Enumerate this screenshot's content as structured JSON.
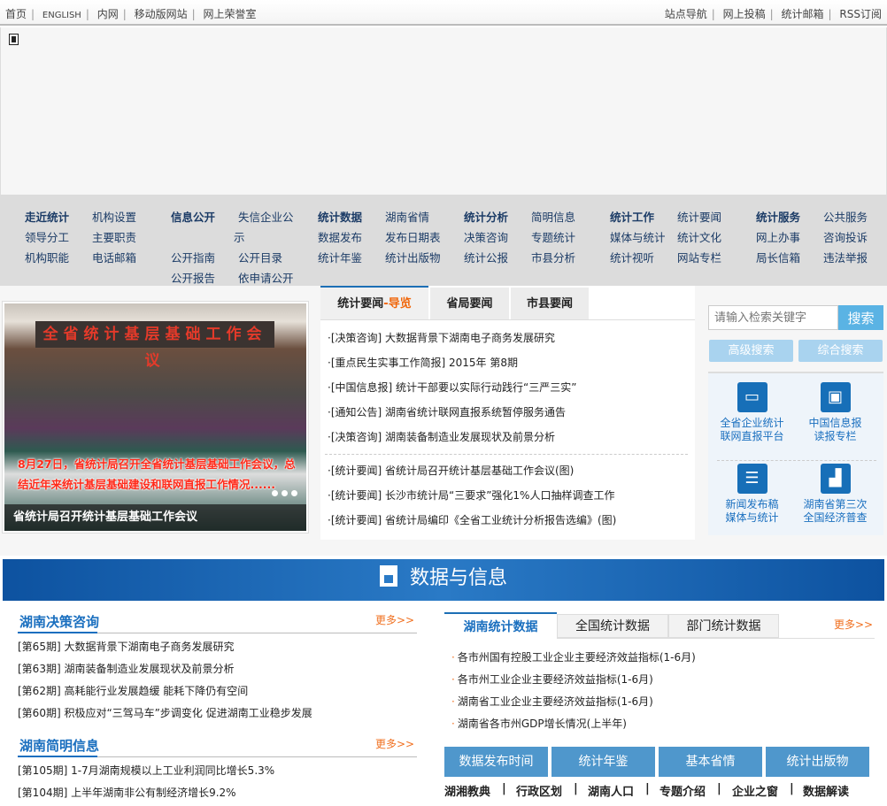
{
  "topbar": {
    "left": [
      "首页",
      "ENGLISH",
      "内网",
      "移动版网站",
      "网上荣誉室"
    ],
    "right": [
      "站点导航",
      "网上投稿",
      "统计邮箱",
      "RSS订阅"
    ]
  },
  "nav": [
    {
      "title": "走近统计",
      "items": [
        "机构设置",
        "领导分工",
        "主要职责",
        "机构职能",
        "电话邮箱"
      ]
    },
    {
      "title": "信息公开",
      "items": [
        "失信企业公",
        "示",
        "公开指南",
        "公开目录",
        "公开报告",
        "依申请公开"
      ]
    },
    {
      "title": "统计数据",
      "items": [
        "湖南省情",
        "数据发布",
        "发布日期表",
        "统计年鉴",
        "统计出版物"
      ]
    },
    {
      "title": "统计分析",
      "items": [
        "简明信息",
        "决策咨询",
        "专题统计",
        "统计公报",
        "市县分析"
      ]
    },
    {
      "title": "统计工作",
      "items": [
        "统计要闻",
        "媒体与统计",
        "统计文化",
        "统计视听",
        "网站专栏"
      ]
    },
    {
      "title": "统计服务",
      "items": [
        "公共服务",
        "网上办事",
        "咨询投诉",
        "局长信箱",
        "违法举报"
      ]
    }
  ],
  "photo": {
    "banner": "全省统计基层基础工作会议",
    "overlay": "8月27日，省统计局召开全省统计基层基础工作会议，总结近年来统计基层基础建设和联网直报工作情况......",
    "caption": "省统计局召开统计基层基础工作会议"
  },
  "news": {
    "tabs": [
      {
        "label": "统计要闻",
        "highlight": "-导览"
      },
      {
        "label": "省局要闻"
      },
      {
        "label": "市县要闻"
      }
    ],
    "items": [
      "·[决策咨询] 大数据背景下湖南电子商务发展研究",
      "·[重点民生实事工作简报] 2015年 第8期",
      "·[中国信息报] 统计干部要以实际行动践行“三严三实”",
      "·[通知公告] 湖南省统计联网直报系统暂停服务通告",
      "·[决策咨询] 湖南装备制造业发展现状及前景分析"
    ],
    "items2": [
      "·[统计要闻] 省统计局召开统计基层基础工作会议(图)",
      "·[统计要闻] 长沙市统计局“三要求”强化1%人口抽样调查工作",
      "·[统计要闻] 省统计局编印《全省工业统计分析报告选编》(图)"
    ]
  },
  "search": {
    "placeholder": "请输入检索关键字",
    "button": "搜索",
    "advanced": "高级搜索",
    "integrated": "综合搜索"
  },
  "quicklinks": [
    {
      "line1": "全省企业统计",
      "line2": "联网直报平台",
      "icon": "monitor-icon"
    },
    {
      "line1": "中国信息报",
      "line2": "读报专栏",
      "icon": "presentation-icon"
    },
    {
      "line1": "新闻发布稿",
      "line2": "媒体与统计",
      "icon": "document-icon"
    },
    {
      "line1": "湖南省第三次",
      "line2": "全国经济普查",
      "icon": "bar-chart-icon"
    }
  ],
  "band": {
    "title": "数据与信息"
  },
  "decision": {
    "title": "湖南决策咨询",
    "more": "更多>>",
    "items": [
      "[第65期] 大数据背景下湖南电子商务发展研究",
      "[第63期] 湖南装备制造业发展现状及前景分析",
      "[第62期] 高耗能行业发展趋缓 能耗下降仍有空间",
      "[第60期] 积极应对“三驾马车”步调变化 促进湖南工业稳步发展"
    ]
  },
  "brief": {
    "title": "湖南简明信息",
    "more": "更多>>",
    "items": [
      "[第105期] 1-7月湖南规模以上工业利润同比增长5.3%",
      "[第104期] 上半年湖南非公有制经济增长9.2%"
    ]
  },
  "stats": {
    "tabs": [
      "湖南统计数据",
      "全国统计数据",
      "部门统计数据"
    ],
    "more": "更多>>",
    "items": [
      "各市州国有控股工业企业主要经济效益指标(1-6月)",
      "各市州工业企业主要经济效益指标(1-6月)",
      "湖南省工业企业主要经济效益指标(1-6月)",
      "湖南省各市州GDP增长情况(上半年)"
    ]
  },
  "buttons": [
    "数据发布时间",
    "统计年鉴",
    "基本省情",
    "统计出版物"
  ],
  "quicknav": [
    "湖湘教典",
    "行政区划",
    "湖南人口",
    "专题介绍",
    "企业之窗",
    "数据解读"
  ]
}
